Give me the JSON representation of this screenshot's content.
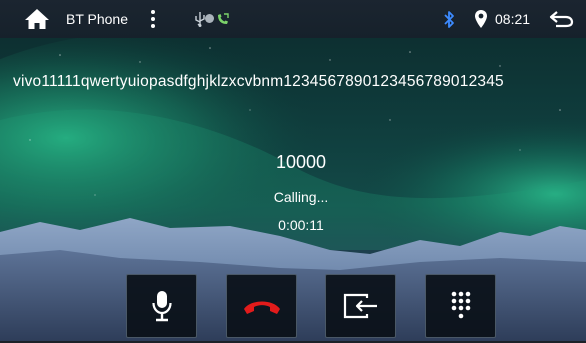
{
  "statusbar": {
    "app_title": "BT Phone",
    "time": "08:21",
    "icons": [
      "home-icon",
      "more-vert-icon",
      "usb-icon",
      "record-dot-icon",
      "phone-call-indicator-icon",
      "bluetooth-icon",
      "location-pin-icon",
      "back-arrow-icon"
    ]
  },
  "call": {
    "caller_name": "vivo11111qwertyuiopasdfghjklzxcvbnm1234567890123456789012345",
    "number": "10000",
    "status": "Calling...",
    "duration": "0:00:11"
  },
  "controls": [
    {
      "name": "mute-button",
      "icon": "microphone-icon"
    },
    {
      "name": "hangup-button",
      "icon": "hang-up-phone-icon",
      "color": "#e21b1b"
    },
    {
      "name": "audio-transfer-button",
      "icon": "transfer-icon"
    },
    {
      "name": "dialpad-button",
      "icon": "dialpad-icon"
    }
  ],
  "colors": {
    "statusbar_bg": "#18232d",
    "hangup_red": "#e21b1b",
    "bluetooth_blue": "#3d8bff"
  }
}
